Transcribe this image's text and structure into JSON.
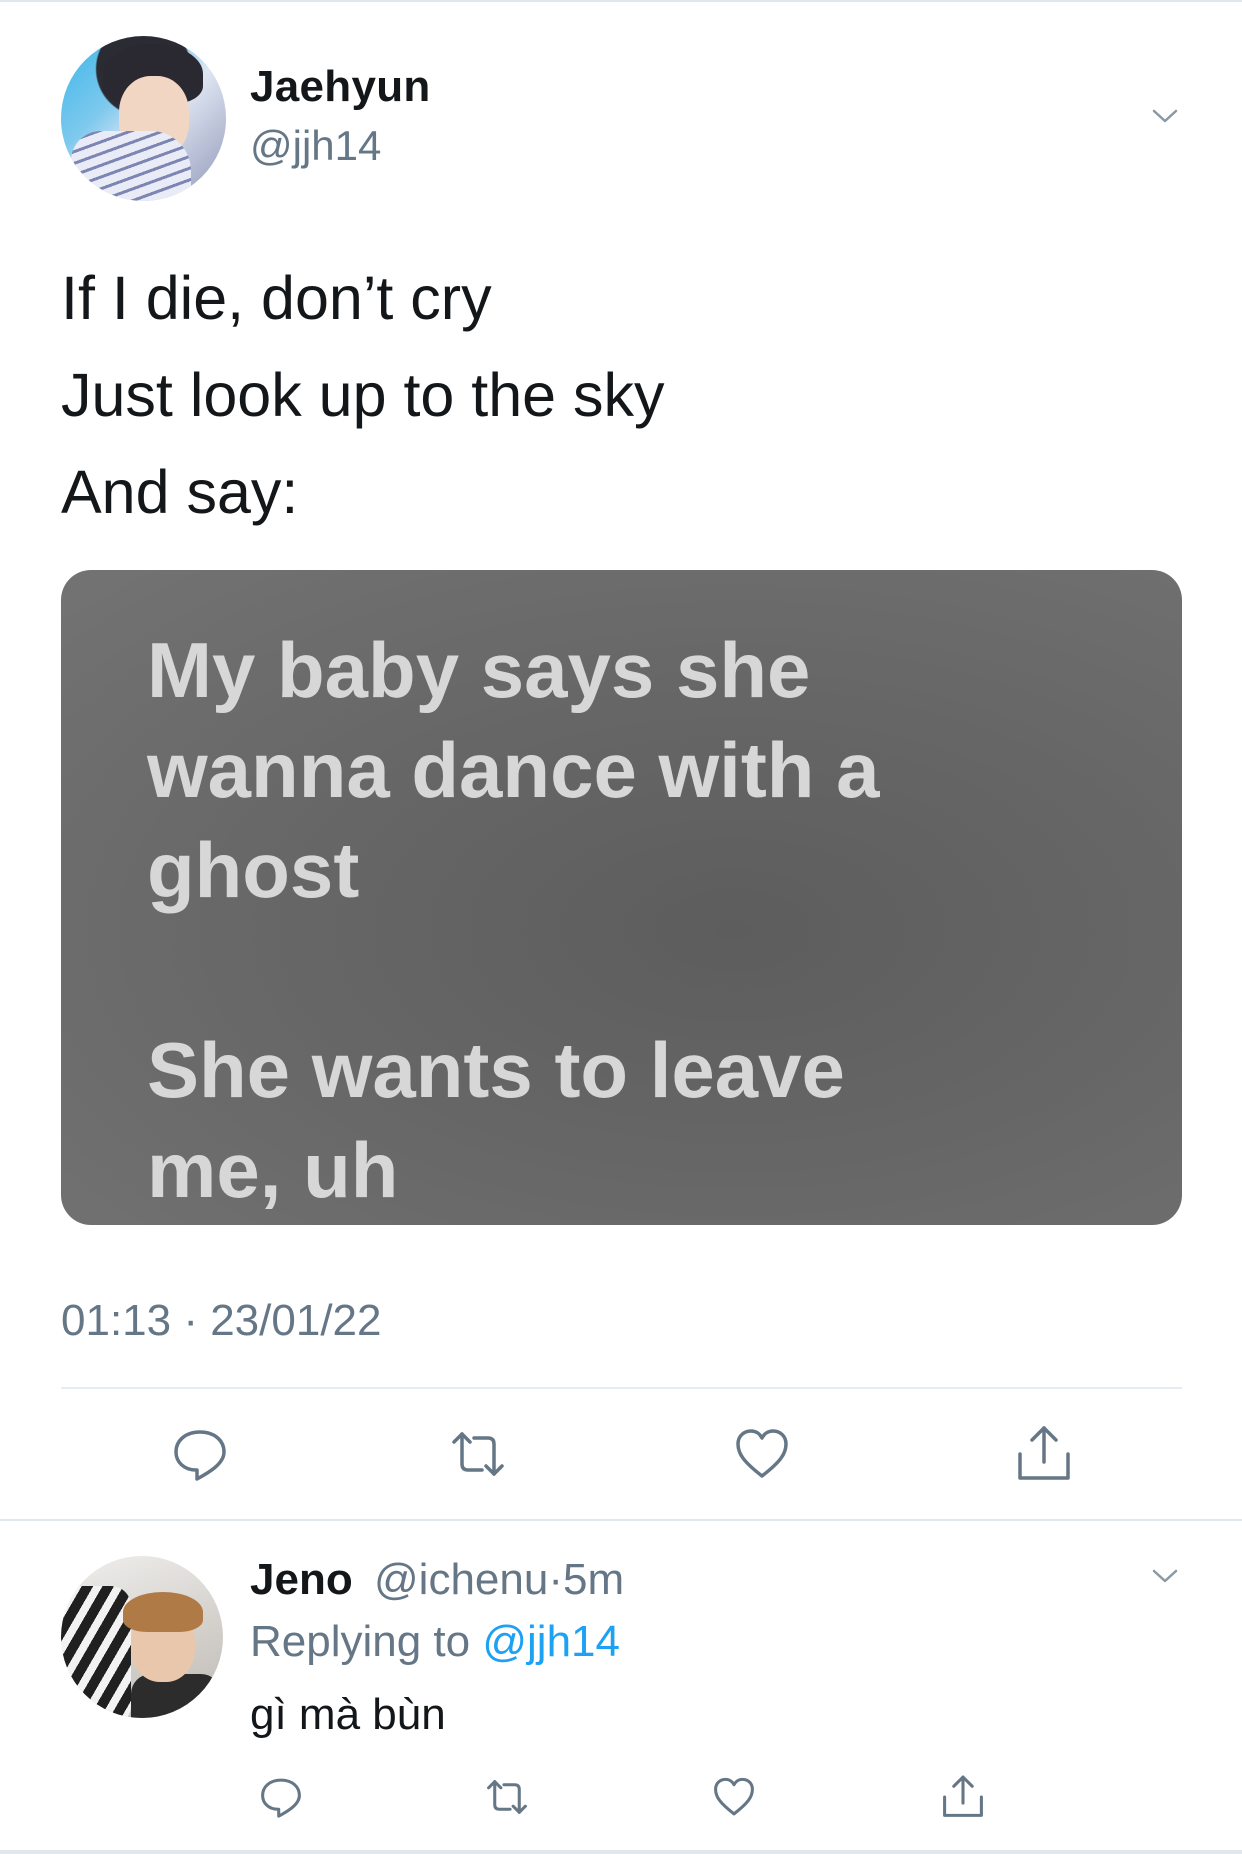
{
  "tweet": {
    "author_name": "Jaehyun",
    "author_handle": "@jjh14",
    "text": "If I die, don’t cry\nJust look up to the sky\nAnd say:",
    "media_text": "My baby says she\nwanna dance with a\nghost\n\nShe wants to leave\nme, uh",
    "timestamp": "01:13 · 23/01/22",
    "actions": [
      "reply-icon",
      "retweet-icon",
      "like-icon",
      "share-icon"
    ]
  },
  "reply": {
    "author_name": "Jeno",
    "author_handle": "@ichenu",
    "time_separator": "·",
    "time": "5m",
    "replying_prefix": "Replying to ",
    "replying_handle": "@jjh14",
    "text": "gì mà bùn",
    "actions": [
      "reply-icon",
      "retweet-icon",
      "like-icon",
      "share-icon"
    ]
  },
  "colors": {
    "text_primary": "#14171a",
    "text_secondary": "#657786",
    "link": "#1da1f2",
    "divider": "#e1e8ed",
    "media_bg": "#666666",
    "media_text": "#d7d7d7"
  }
}
